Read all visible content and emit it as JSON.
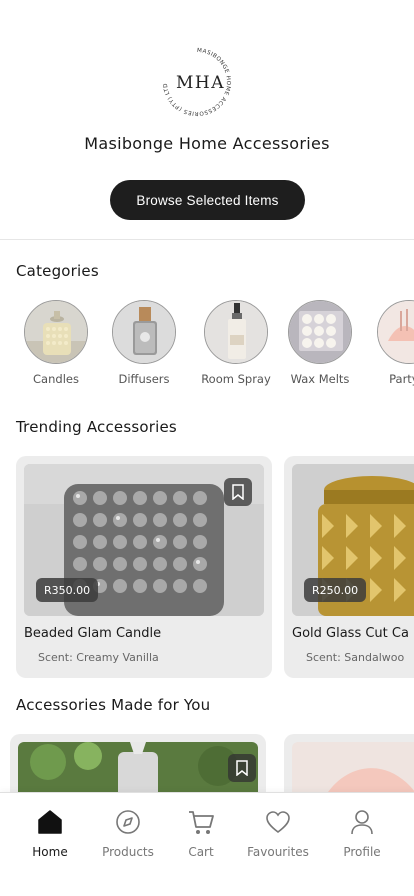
{
  "header": {
    "logo_text": "MHA",
    "logo_ring_text": "MASIBONGE HOME ACCESSORIES (PTY) LTD",
    "store_name": "Masibonge Home Accessories",
    "browse_label": "Browse Selected Items"
  },
  "categories": {
    "title": "Categories",
    "items": [
      {
        "label": "Candles",
        "icon": "candle-jar-image"
      },
      {
        "label": "Diffusers",
        "icon": "diffuser-image"
      },
      {
        "label": "Room Spray",
        "icon": "room-spray-image"
      },
      {
        "label": "Wax Melts",
        "icon": "wax-melts-image"
      },
      {
        "label": "Party F",
        "icon": "party-favours-image"
      }
    ]
  },
  "trending": {
    "title": "Trending Accessories",
    "items": [
      {
        "name": "Beaded Glam Candle",
        "scent": "Scent: Creamy Vanilla",
        "price": "R350.00",
        "icon": "bookmark-icon"
      },
      {
        "name": "Gold Glass Cut Ca",
        "scent": "Scent: Sandalwoo",
        "price": "R250.00",
        "icon": "bookmark-icon"
      }
    ]
  },
  "made_for_you": {
    "title": "Accessories Made for You"
  },
  "nav": {
    "items": [
      {
        "label": "Home",
        "icon": "home-icon",
        "active": true
      },
      {
        "label": "Products",
        "icon": "compass-icon",
        "active": false
      },
      {
        "label": "Cart",
        "icon": "cart-icon",
        "active": false
      },
      {
        "label": "Favourites",
        "icon": "heart-icon",
        "active": false
      },
      {
        "label": "Profile",
        "icon": "person-icon",
        "active": false
      }
    ]
  },
  "colors": {
    "primary_button": "#1e1e1e",
    "card_background": "#ececec",
    "active_nav": "#1a1a1a",
    "inactive_nav": "#777777"
  }
}
